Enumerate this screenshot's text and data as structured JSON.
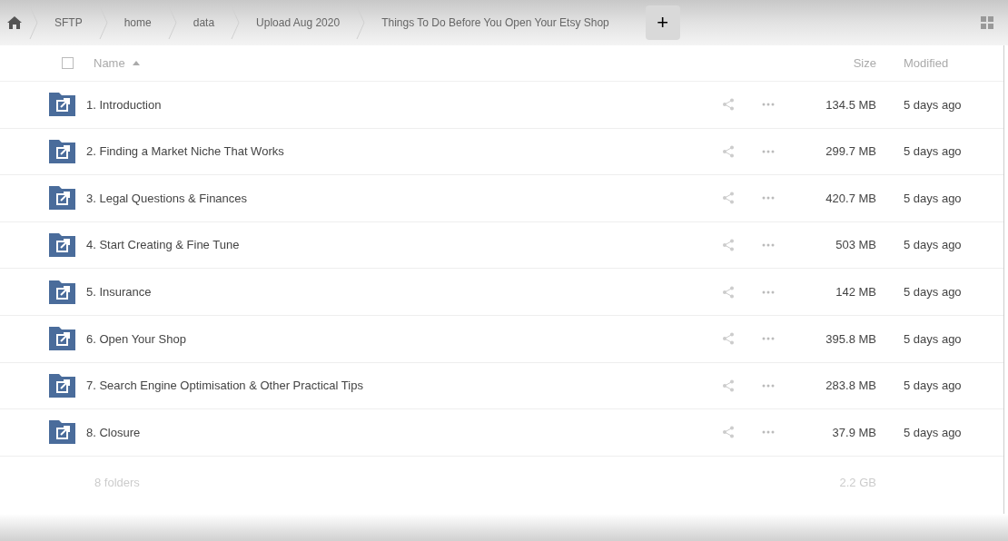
{
  "breadcrumbs": [
    {
      "label": "SFTP"
    },
    {
      "label": "home"
    },
    {
      "label": "data"
    },
    {
      "label": "Upload Aug 2020"
    },
    {
      "label": "Things To Do Before You Open Your Etsy Shop"
    }
  ],
  "add_button": "+",
  "table": {
    "select_all": {
      "checked": false
    },
    "columns": [
      "Name",
      "Size",
      "Modified"
    ],
    "rows": [
      {
        "name": "1. Introduction",
        "size": "134.5 MB",
        "modified": "5 days ago"
      },
      {
        "name": "2. Finding a Market Niche That Works",
        "size": "299.7 MB",
        "modified": "5 days ago"
      },
      {
        "name": "3. Legal Questions & Finances",
        "size": "420.7 MB",
        "modified": "5 days ago"
      },
      {
        "name": "4. Start Creating & Fine Tune",
        "size": "503 MB",
        "modified": "5 days ago"
      },
      {
        "name": "5. Insurance",
        "size": "142 MB",
        "modified": "5 days ago"
      },
      {
        "name": "6. Open Your Shop",
        "size": "395.8 MB",
        "modified": "5 days ago"
      },
      {
        "name": "7. Search Engine Optimisation & Other Practical Tips",
        "size": "283.8 MB",
        "modified": "5 days ago"
      },
      {
        "name": "8. Closure",
        "size": "37.9 MB",
        "modified": "5 days ago"
      }
    ],
    "summary": {
      "count": "8 folders",
      "total": "2.2 GB"
    }
  }
}
